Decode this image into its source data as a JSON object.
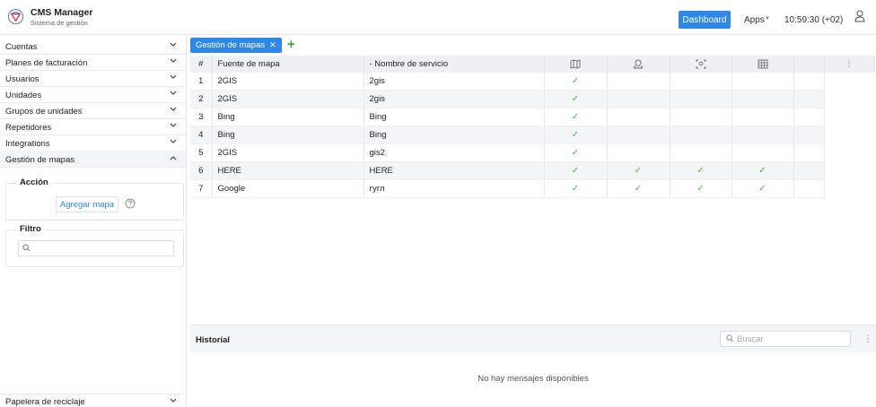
{
  "header": {
    "app_title": "CMS Manager",
    "app_subtitle": "Sistema de gestión",
    "dashboard_label": "Dashboard",
    "apps_label": "Apps",
    "apps_caret": "▼",
    "clock": "10:59:30 (+02)"
  },
  "sidebar": {
    "items": [
      {
        "label": "Cuentas"
      },
      {
        "label": "Planes de facturación"
      },
      {
        "label": "Usuarios"
      },
      {
        "label": "Unidades"
      },
      {
        "label": "Grupos de unidades"
      },
      {
        "label": "Repetidores"
      },
      {
        "label": "Integrations"
      },
      {
        "label": "Gestión de mapas"
      }
    ],
    "action_legend": "Acción",
    "add_map_label": "Agregar mapa",
    "filter_legend": "Filtro",
    "filter_placeholder": "",
    "bottom_item": "Papelera de reciclaje"
  },
  "main": {
    "tab_label": "Gestión de mapas",
    "tab_close": "✕",
    "tab_add": "+",
    "table": {
      "col_num": "#",
      "col_source": "Fuente de mapa",
      "col_service": "- Nombre de servicio",
      "col_menu": "⋮",
      "rows": [
        {
          "n": "1",
          "source": "2GIS",
          "service": "2gis",
          "c1": "✓",
          "c2": "",
          "c3": "",
          "c4": ""
        },
        {
          "n": "2",
          "source": "2GIS",
          "service": "2gis",
          "c1": "✓",
          "c2": "",
          "c3": "",
          "c4": ""
        },
        {
          "n": "3",
          "source": "Bing",
          "service": "Bing",
          "c1": "✓",
          "c2": "",
          "c3": "",
          "c4": ""
        },
        {
          "n": "4",
          "source": "Bing",
          "service": "Bing",
          "c1": "✓",
          "c2": "",
          "c3": "",
          "c4": ""
        },
        {
          "n": "5",
          "source": "2GIS",
          "service": "gis2",
          "c1": "✓",
          "c2": "",
          "c3": "",
          "c4": ""
        },
        {
          "n": "6",
          "source": "HERE",
          "service": "HERE",
          "c1": "✓",
          "c2": "✓",
          "c3": "✓",
          "c4": "✓"
        },
        {
          "n": "7",
          "source": "Google",
          "service": "гугл",
          "c1": "✓",
          "c2": "✓",
          "c3": "✓",
          "c4": "✓"
        }
      ]
    },
    "history_title": "Historial",
    "search_placeholder": "Buscar",
    "history_menu": "⋮",
    "empty_message": "No hay mensajes disponibles"
  },
  "colors": {
    "accent": "#2f88e8",
    "check": "#4caf50",
    "add": "#3aa23a"
  }
}
